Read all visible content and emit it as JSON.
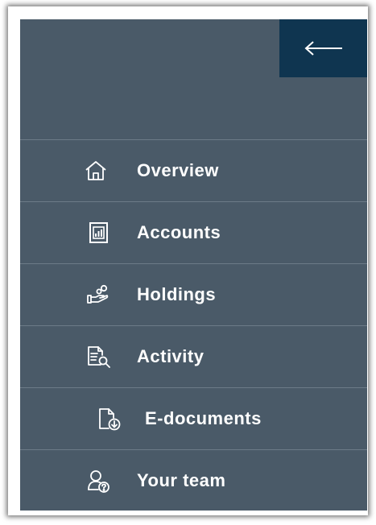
{
  "sidebar": {
    "collapse_button": {
      "icon": "arrow-left-icon"
    },
    "items": [
      {
        "label": "Overview",
        "icon": "home-icon"
      },
      {
        "label": "Accounts",
        "icon": "account-statement-icon"
      },
      {
        "label": "Holdings",
        "icon": "hand-coins-icon"
      },
      {
        "label": "Activity",
        "icon": "document-search-icon"
      },
      {
        "label": "E-documents",
        "icon": "document-download-icon"
      },
      {
        "label": "Your team",
        "icon": "team-advisor-icon"
      }
    ]
  },
  "colors": {
    "sidebar_bg": "#4a5a68",
    "collapse_button_bg": "#0f3550",
    "divider": "#6c7b88",
    "text": "#ffffff"
  }
}
